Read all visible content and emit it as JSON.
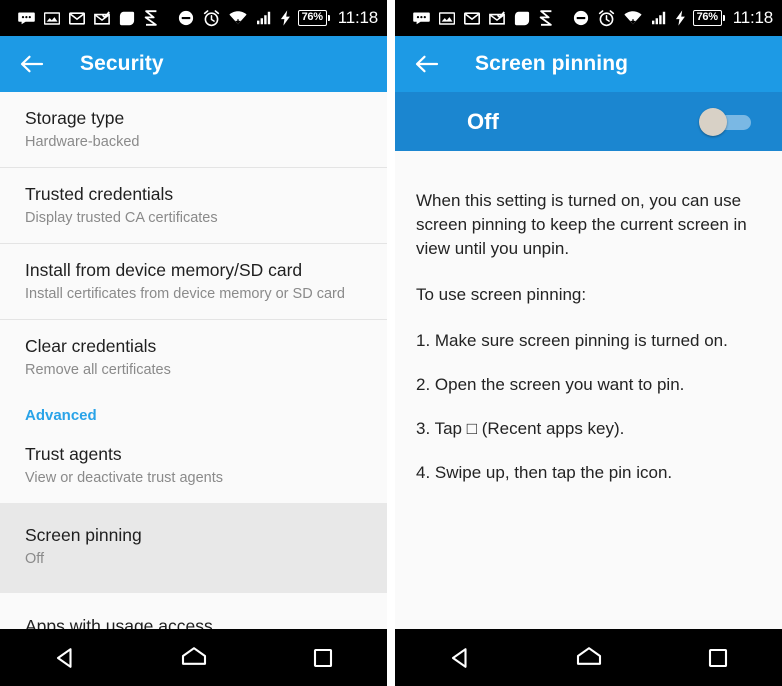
{
  "status_bar": {
    "icons": [
      "messages-icon",
      "photo-icon",
      "envelope-icon",
      "envelope-check-icon",
      "leaf-shape-icon",
      "s-logo-icon",
      "do-not-disturb-icon",
      "alarm-icon",
      "wifi-icon",
      "signal-icon",
      "charging-bolt-icon"
    ],
    "battery": "76%",
    "time": "11:18"
  },
  "colors": {
    "accent_blue": "#1d9ae5",
    "toggle_bar_blue": "#1b86d0",
    "section_header_blue": "#29a3e8",
    "highlight_gray": "#e8e8e8",
    "background": "#fafafa",
    "knob": "#d8d1c6"
  },
  "left_screen": {
    "appbar": {
      "back_label": "Back",
      "title": "Security"
    },
    "items": [
      {
        "title": "Storage type",
        "subtitle": "Hardware-backed",
        "highlight": false
      },
      {
        "title": "Trusted credentials",
        "subtitle": "Display trusted CA certificates",
        "highlight": false
      },
      {
        "title": "Install from device memory/SD card",
        "subtitle": "Install certificates from device memory or SD card",
        "highlight": false
      },
      {
        "title": "Clear credentials",
        "subtitle": "Remove all certificates",
        "highlight": false
      }
    ],
    "section_header": "Advanced",
    "advanced_items": [
      {
        "title": "Trust agents",
        "subtitle": "View or deactivate trust agents",
        "highlight": false
      },
      {
        "title": "Screen pinning",
        "subtitle": "Off",
        "highlight": true
      },
      {
        "title": "Apps with usage access",
        "subtitle": "",
        "highlight": false
      }
    ]
  },
  "right_screen": {
    "appbar": {
      "back_label": "Back",
      "title": "Screen pinning"
    },
    "toggle": {
      "state_label": "Off",
      "checked": false
    },
    "description": {
      "intro": "When this setting is turned on, you can use screen pinning to keep the current screen in view until you unpin.",
      "lead_in": "To use screen pinning:",
      "steps": [
        "1. Make sure screen pinning is turned on.",
        "2. Open the screen you want to pin.",
        "3. Tap □ (Recent apps key).",
        "4. Swipe up, then tap the pin icon."
      ]
    }
  },
  "nav_bar": {
    "back": "back-nav-button",
    "home": "home-nav-button",
    "recents": "recents-nav-button"
  }
}
